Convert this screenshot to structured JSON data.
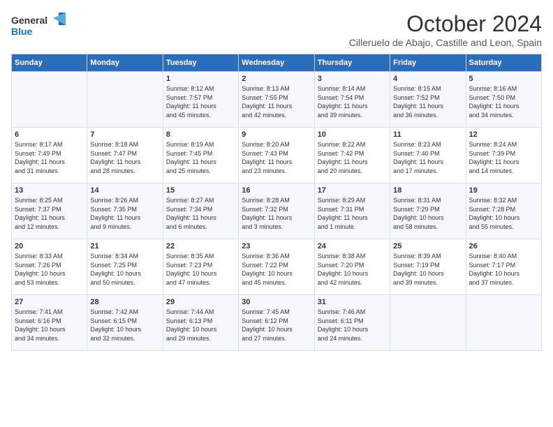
{
  "logo": {
    "line1": "General",
    "line2": "Blue"
  },
  "title": "October 2024",
  "location": "Cilleruelo de Abajo, Castille and Leon, Spain",
  "days_of_week": [
    "Sunday",
    "Monday",
    "Tuesday",
    "Wednesday",
    "Thursday",
    "Friday",
    "Saturday"
  ],
  "weeks": [
    [
      {
        "day": "",
        "info": ""
      },
      {
        "day": "",
        "info": ""
      },
      {
        "day": "1",
        "info": "Sunrise: 8:12 AM\nSunset: 7:57 PM\nDaylight: 11 hours\nand 45 minutes."
      },
      {
        "day": "2",
        "info": "Sunrise: 8:13 AM\nSunset: 7:55 PM\nDaylight: 11 hours\nand 42 minutes."
      },
      {
        "day": "3",
        "info": "Sunrise: 8:14 AM\nSunset: 7:54 PM\nDaylight: 11 hours\nand 39 minutes."
      },
      {
        "day": "4",
        "info": "Sunrise: 8:15 AM\nSunset: 7:52 PM\nDaylight: 11 hours\nand 36 minutes."
      },
      {
        "day": "5",
        "info": "Sunrise: 8:16 AM\nSunset: 7:50 PM\nDaylight: 11 hours\nand 34 minutes."
      }
    ],
    [
      {
        "day": "6",
        "info": "Sunrise: 8:17 AM\nSunset: 7:49 PM\nDaylight: 11 hours\nand 31 minutes."
      },
      {
        "day": "7",
        "info": "Sunrise: 8:18 AM\nSunset: 7:47 PM\nDaylight: 11 hours\nand 28 minutes."
      },
      {
        "day": "8",
        "info": "Sunrise: 8:19 AM\nSunset: 7:45 PM\nDaylight: 11 hours\nand 25 minutes."
      },
      {
        "day": "9",
        "info": "Sunrise: 8:20 AM\nSunset: 7:43 PM\nDaylight: 11 hours\nand 23 minutes."
      },
      {
        "day": "10",
        "info": "Sunrise: 8:22 AM\nSunset: 7:42 PM\nDaylight: 11 hours\nand 20 minutes."
      },
      {
        "day": "11",
        "info": "Sunrise: 8:23 AM\nSunset: 7:40 PM\nDaylight: 11 hours\nand 17 minutes."
      },
      {
        "day": "12",
        "info": "Sunrise: 8:24 AM\nSunset: 7:39 PM\nDaylight: 11 hours\nand 14 minutes."
      }
    ],
    [
      {
        "day": "13",
        "info": "Sunrise: 8:25 AM\nSunset: 7:37 PM\nDaylight: 11 hours\nand 12 minutes."
      },
      {
        "day": "14",
        "info": "Sunrise: 8:26 AM\nSunset: 7:35 PM\nDaylight: 11 hours\nand 9 minutes."
      },
      {
        "day": "15",
        "info": "Sunrise: 8:27 AM\nSunset: 7:34 PM\nDaylight: 11 hours\nand 6 minutes."
      },
      {
        "day": "16",
        "info": "Sunrise: 8:28 AM\nSunset: 7:32 PM\nDaylight: 11 hours\nand 3 minutes."
      },
      {
        "day": "17",
        "info": "Sunrise: 8:29 AM\nSunset: 7:31 PM\nDaylight: 11 hours\nand 1 minute."
      },
      {
        "day": "18",
        "info": "Sunrise: 8:31 AM\nSunset: 7:29 PM\nDaylight: 10 hours\nand 58 minutes."
      },
      {
        "day": "19",
        "info": "Sunrise: 8:32 AM\nSunset: 7:28 PM\nDaylight: 10 hours\nand 55 minutes."
      }
    ],
    [
      {
        "day": "20",
        "info": "Sunrise: 8:33 AM\nSunset: 7:26 PM\nDaylight: 10 hours\nand 53 minutes."
      },
      {
        "day": "21",
        "info": "Sunrise: 8:34 AM\nSunset: 7:25 PM\nDaylight: 10 hours\nand 50 minutes."
      },
      {
        "day": "22",
        "info": "Sunrise: 8:35 AM\nSunset: 7:23 PM\nDaylight: 10 hours\nand 47 minutes."
      },
      {
        "day": "23",
        "info": "Sunrise: 8:36 AM\nSunset: 7:22 PM\nDaylight: 10 hours\nand 45 minutes."
      },
      {
        "day": "24",
        "info": "Sunrise: 8:38 AM\nSunset: 7:20 PM\nDaylight: 10 hours\nand 42 minutes."
      },
      {
        "day": "25",
        "info": "Sunrise: 8:39 AM\nSunset: 7:19 PM\nDaylight: 10 hours\nand 39 minutes."
      },
      {
        "day": "26",
        "info": "Sunrise: 8:40 AM\nSunset: 7:17 PM\nDaylight: 10 hours\nand 37 minutes."
      }
    ],
    [
      {
        "day": "27",
        "info": "Sunrise: 7:41 AM\nSunset: 6:16 PM\nDaylight: 10 hours\nand 34 minutes."
      },
      {
        "day": "28",
        "info": "Sunrise: 7:42 AM\nSunset: 6:15 PM\nDaylight: 10 hours\nand 32 minutes."
      },
      {
        "day": "29",
        "info": "Sunrise: 7:44 AM\nSunset: 6:13 PM\nDaylight: 10 hours\nand 29 minutes."
      },
      {
        "day": "30",
        "info": "Sunrise: 7:45 AM\nSunset: 6:12 PM\nDaylight: 10 hours\nand 27 minutes."
      },
      {
        "day": "31",
        "info": "Sunrise: 7:46 AM\nSunset: 6:11 PM\nDaylight: 10 hours\nand 24 minutes."
      },
      {
        "day": "",
        "info": ""
      },
      {
        "day": "",
        "info": ""
      }
    ]
  ]
}
